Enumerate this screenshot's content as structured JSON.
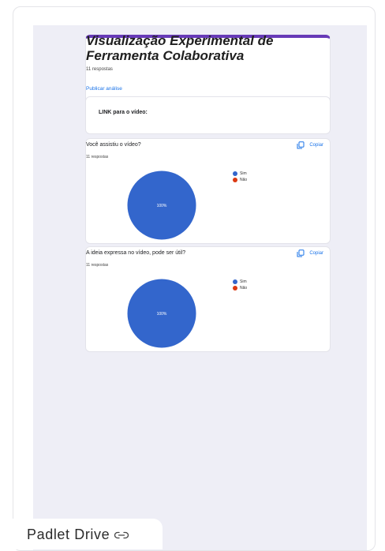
{
  "form": {
    "title": "Visualização Experimental de Ferramenta Colaborativa",
    "response_count": "11 respostas",
    "publish_link": "Publicar análise"
  },
  "link_section": {
    "label": "LINK para o vídeo:"
  },
  "questions": [
    {
      "title": "Você assistiu o vídeo?",
      "response_count": "11 respostas",
      "copy_label": "Copiar",
      "chart_label": "100%",
      "legend": [
        {
          "label": "Sim",
          "color": "#3366cc"
        },
        {
          "label": "Não",
          "color": "#dc3912"
        }
      ]
    },
    {
      "title": "A ideia expressa no vídeo, pode ser útil?",
      "response_count": "11 respostas",
      "copy_label": "Copiar",
      "chart_label": "100%",
      "legend": [
        {
          "label": "Sim",
          "color": "#3366cc"
        },
        {
          "label": "Não",
          "color": "#dc3912"
        }
      ]
    }
  ],
  "chart_data": [
    {
      "type": "pie",
      "categories": [
        "Sim",
        "Não"
      ],
      "values": [
        100,
        0
      ],
      "title": "Você assistiu o vídeo?"
    },
    {
      "type": "pie",
      "categories": [
        "Sim",
        "Não"
      ],
      "values": [
        100,
        0
      ],
      "title": "A ideia expressa no vídeo, pode ser útil?"
    }
  ],
  "footer": {
    "label": "Padlet Drive",
    "icon": "link-icon"
  }
}
